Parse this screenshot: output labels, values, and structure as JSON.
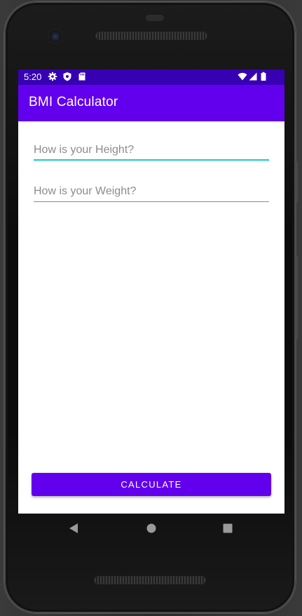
{
  "status_bar": {
    "time": "5:20",
    "left_icons": [
      "gear-icon",
      "shield-icon",
      "sd-card-icon"
    ],
    "right_icons": [
      "wifi-icon",
      "signal-icon",
      "battery-icon"
    ]
  },
  "app_bar": {
    "title": "BMI Calculator"
  },
  "form": {
    "height_field": {
      "value": "",
      "placeholder": "How is your Height?",
      "focused": true
    },
    "weight_field": {
      "value": "",
      "placeholder": "How is your Weight?",
      "focused": false
    }
  },
  "actions": {
    "calculate_label": "CALCULATE"
  },
  "nav_bar": {
    "icons": [
      "back-icon",
      "home-icon",
      "recents-icon"
    ]
  },
  "colors": {
    "status_bar": "#3700b3",
    "primary": "#6200ee",
    "focus_accent": "#1ac9c9"
  }
}
